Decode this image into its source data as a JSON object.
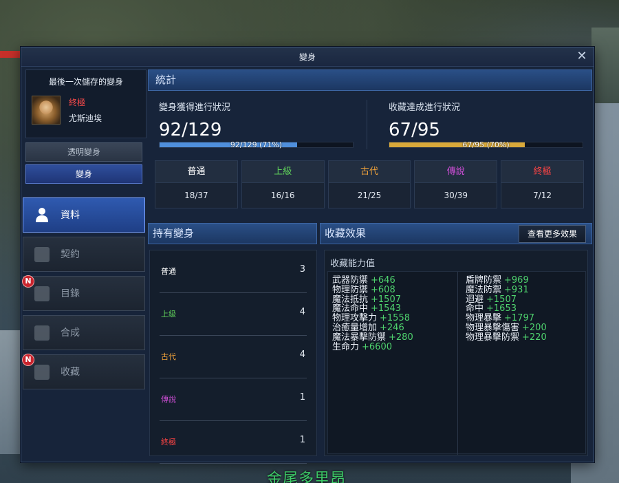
{
  "window": {
    "title": "變身"
  },
  "saved": {
    "title": "最後一次儲存的變身",
    "grade": "終極",
    "name": "尤斯迪埃"
  },
  "buttons": {
    "transparent": "透明變身",
    "transform": "變身",
    "more_effects": "查看更多效果"
  },
  "nav": [
    {
      "label": "資料",
      "icon": "person-icon",
      "active": true,
      "badge": ""
    },
    {
      "label": "契約",
      "icon": "contract-icon",
      "active": false,
      "badge": ""
    },
    {
      "label": "目錄",
      "icon": "catalog-icon",
      "active": false,
      "badge": "N"
    },
    {
      "label": "合成",
      "icon": "combine-icon",
      "active": false,
      "badge": ""
    },
    {
      "label": "收藏",
      "icon": "collection-icon",
      "active": false,
      "badge": "N"
    }
  ],
  "stats": {
    "header": "統計",
    "acquire": {
      "title": "變身獲得進行狀況",
      "value": "92/129",
      "bar_text": "92/129 (71%)",
      "percent": 71,
      "color": "#4f8fdc"
    },
    "collection": {
      "title": "收藏達成進行狀況",
      "value": "67/95",
      "bar_text": "67/95 (70%)",
      "percent": 70,
      "color": "#d9a93a"
    }
  },
  "grades": [
    {
      "name": "普通",
      "count": "18/37",
      "color": "#ffffff"
    },
    {
      "name": "上級",
      "count": "16/16",
      "color": "#5fcf5a"
    },
    {
      "name": "古代",
      "count": "21/25",
      "color": "#f0a23a"
    },
    {
      "name": "傳說",
      "count": "30/39",
      "color": "#d04fd8"
    },
    {
      "name": "終極",
      "count": "7/12",
      "color": "#ff4444"
    }
  ],
  "owned": {
    "header": "持有變身",
    "items": [
      {
        "name": "普通",
        "count": "3",
        "color": "#ffffff"
      },
      {
        "name": "上級",
        "count": "4",
        "color": "#5fcf5a"
      },
      {
        "name": "古代",
        "count": "4",
        "color": "#f0a23a"
      },
      {
        "name": "傳說",
        "count": "1",
        "color": "#d04fd8"
      },
      {
        "name": "終極",
        "count": "1",
        "color": "#ff4444"
      }
    ]
  },
  "effects": {
    "header": "收藏效果",
    "title": "收藏能力值",
    "left": [
      {
        "name": "武器防禦",
        "value": "+646"
      },
      {
        "name": "物理防禦",
        "value": "+608"
      },
      {
        "name": "魔法抵抗",
        "value": "+1507"
      },
      {
        "name": "魔法命中",
        "value": "+1543"
      },
      {
        "name": "物理攻擊力",
        "value": "+1558"
      },
      {
        "name": "治癒量增加",
        "value": "+246"
      },
      {
        "name": "魔法暴擊防禦",
        "value": "+280"
      },
      {
        "name": "生命力",
        "value": "+6600"
      }
    ],
    "right": [
      {
        "name": "盾牌防禦",
        "value": "+969"
      },
      {
        "name": "魔法防禦",
        "value": "+931"
      },
      {
        "name": "迴避",
        "value": "+1507"
      },
      {
        "name": "命中",
        "value": "+1653"
      },
      {
        "name": "物理暴擊",
        "value": "+1797"
      },
      {
        "name": "物理暴擊傷害",
        "value": "+200"
      },
      {
        "name": "物理暴擊防禦",
        "value": "+220"
      }
    ]
  },
  "world": {
    "npc_name": "金尾多里昂"
  }
}
